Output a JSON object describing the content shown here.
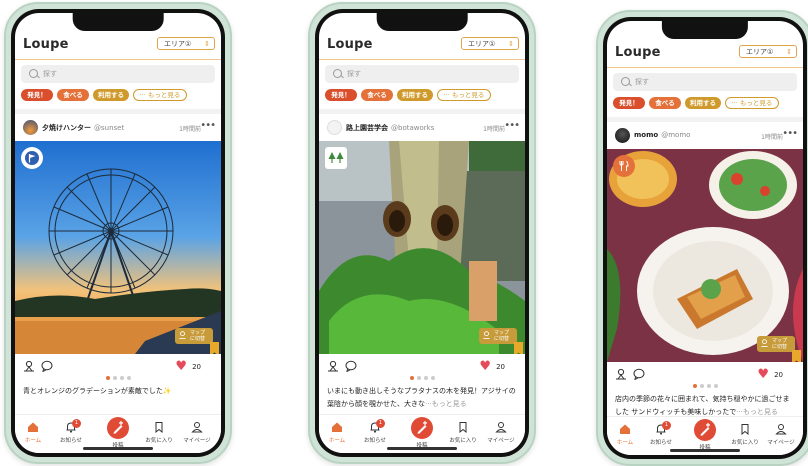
{
  "app": {
    "logo": "Loupe",
    "area": "エリア①",
    "search_placeholder": "探す"
  },
  "chips": [
    "発見！",
    "食べる",
    "利用する",
    "··· もっと見る"
  ],
  "tabs": [
    "ホーム",
    "お知らせ",
    "投稿",
    "お気に入り",
    "マイページ"
  ],
  "notification_count": "1",
  "map_button": [
    "マップ",
    "に切替"
  ],
  "colors": {
    "accent": "#e5713a",
    "red": "#d94e2b",
    "gold": "#cf9a2b",
    "heart": "#e44a5a"
  },
  "phones": [
    {
      "user": "夕焼けハンター",
      "handle": "@sunset",
      "time": "1時間前",
      "category_icon": "flag-icon",
      "likes": "20",
      "caption": "青とオレンジのグラデーションが素敵でした✨",
      "caption_more": "",
      "photo": "ferris-wheel-sunset"
    },
    {
      "user": "路上園芸学会",
      "handle": "@botaworks",
      "time": "1時間前",
      "category_icon": "trees-icon",
      "likes": "20",
      "caption": "いまにも動き出しそうなプラタナスの木を発見！アジサイの葉陰から顔を覗かせた、大きな",
      "caption_more": "···もっと見る",
      "photo": "plane-tree-face"
    },
    {
      "user": "momo",
      "handle": "@momo",
      "time": "1時間前",
      "category_icon": "fork-knife-icon",
      "likes": "20",
      "caption": "店内の季節の花々に囲まれて、気持ち穏やかに過ごせました サンドウィッチも美味しかったで",
      "caption_more": "···もっと見る",
      "photo": "cafe-food-table"
    }
  ]
}
